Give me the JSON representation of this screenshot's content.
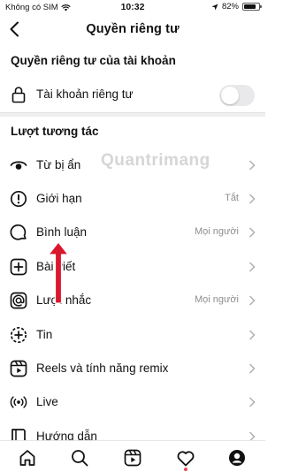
{
  "status": {
    "carrier": "Không có SIM",
    "time": "10:32",
    "battery_percent": "82%",
    "battery_level": 0.82
  },
  "header": {
    "title": "Quyền riêng tư"
  },
  "account_section": {
    "title": "Quyền riêng tư của tài khoản",
    "private_label": "Tài khoản riêng tư",
    "private_on": false
  },
  "interactions_section": {
    "title": "Lượt tương tác",
    "items": [
      {
        "label": "Từ bị ẩn",
        "value": "",
        "icon": "eye-icon"
      },
      {
        "label": "Giới hạn",
        "value": "Tắt",
        "icon": "restrict-icon"
      },
      {
        "label": "Bình luận",
        "value": "Mọi người",
        "icon": "comment-icon"
      },
      {
        "label": "Bài viết",
        "value": "",
        "icon": "post-plus-icon"
      },
      {
        "label": "Lượt nhắc",
        "value": "Mọi người",
        "icon": "mention-icon"
      },
      {
        "label": "Tin",
        "value": "",
        "icon": "story-icon"
      },
      {
        "label": "Reels và tính năng remix",
        "value": "",
        "icon": "reels-icon"
      },
      {
        "label": "Live",
        "value": "",
        "icon": "live-icon"
      },
      {
        "label": "Hướng dẫn",
        "value": "",
        "icon": "guides-icon"
      }
    ]
  },
  "watermark": "Quantrimang",
  "tabs": [
    {
      "name": "home",
      "icon": "home-icon"
    },
    {
      "name": "search",
      "icon": "search-icon"
    },
    {
      "name": "reels",
      "icon": "reels-tab-icon"
    },
    {
      "name": "activity",
      "icon": "heart-icon"
    },
    {
      "name": "profile",
      "icon": "profile-icon"
    }
  ],
  "colors": {
    "accent_arrow": "#d9182d",
    "notification_dot": "#ed4956",
    "secondary_text": "#8e8e8e",
    "toggle_off": "#e9e9eb"
  }
}
